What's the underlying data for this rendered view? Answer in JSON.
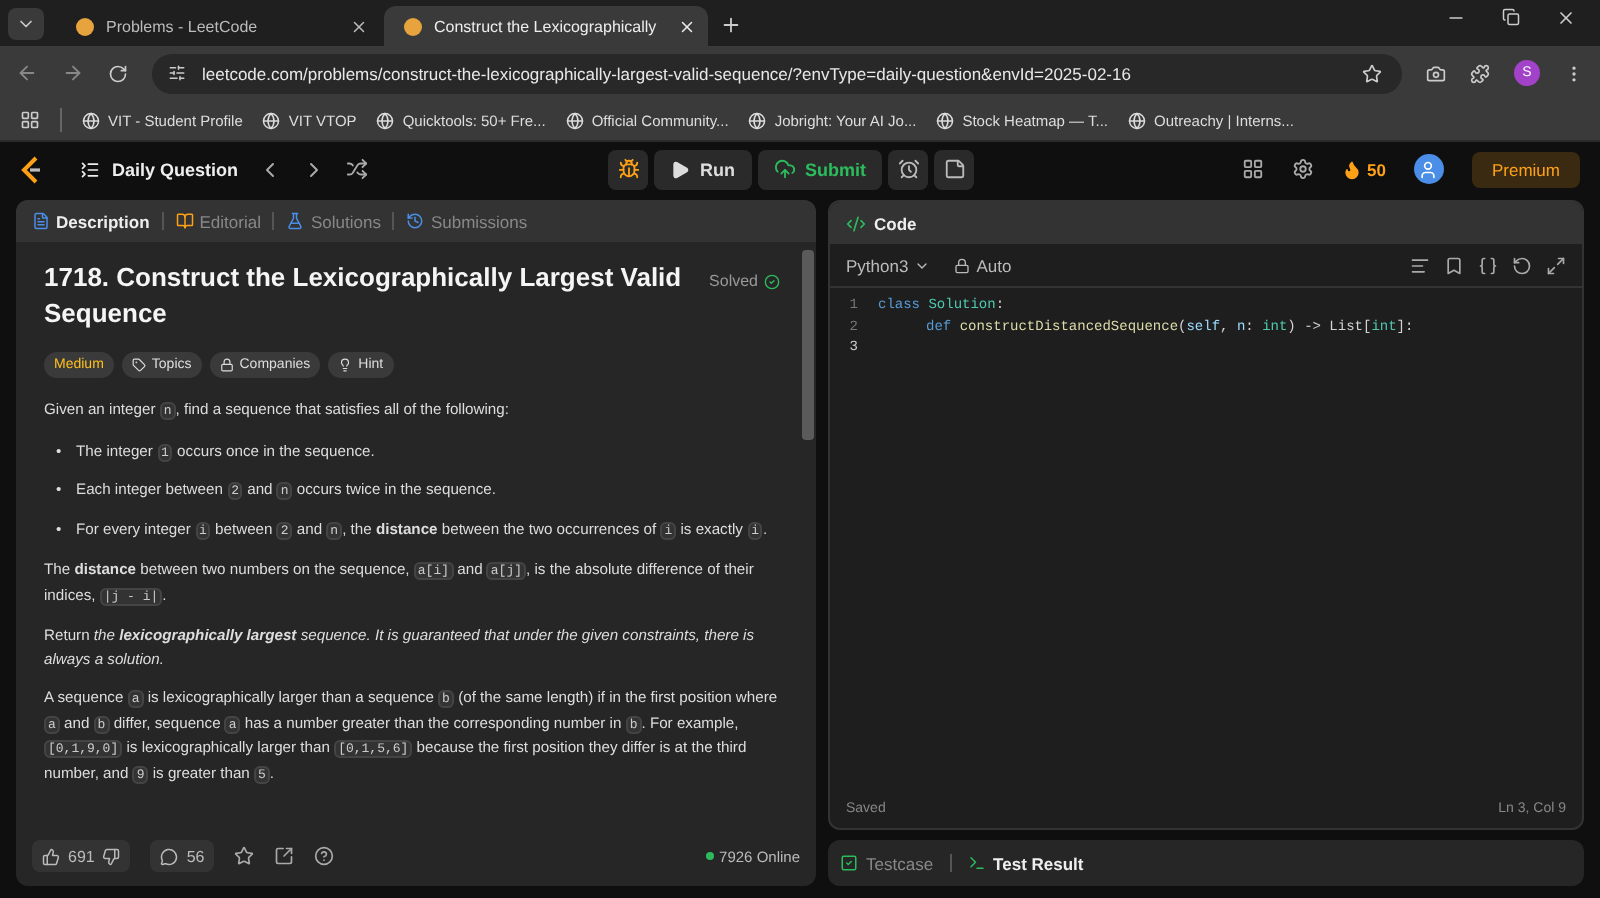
{
  "browser": {
    "tabs": [
      {
        "title": "Problems - LeetCode",
        "selected": false
      },
      {
        "title": "Construct the Lexicographically",
        "selected": true
      }
    ],
    "url": "leetcode.com/problems/construct-the-lexicographically-largest-valid-sequence/?envType=daily-question&envId=2025-02-16",
    "profile_initial": "S",
    "bookmarks": [
      "VIT - Student Profile",
      "VIT VTOP",
      "Quicktools: 50+ Fre...",
      "Official Community...",
      "Jobright: Your AI Jo...",
      "Stock Heatmap — T...",
      "Outreachy | Interns..."
    ]
  },
  "nav": {
    "title": "Daily Question",
    "run": "Run",
    "submit": "Submit",
    "streak": "50",
    "premium": "Premium"
  },
  "problem": {
    "tabs": [
      {
        "label": "Description",
        "selected": true
      },
      {
        "label": "Editorial",
        "selected": false
      },
      {
        "label": "Solutions",
        "selected": false
      },
      {
        "label": "Submissions",
        "selected": false
      }
    ],
    "title": "1718. Construct the Lexicographically Largest Valid Sequence",
    "status": "Solved",
    "difficulty": "Medium",
    "tags": [
      "Topics",
      "Companies",
      "Hint"
    ],
    "intro": [
      {
        "kind": "text",
        "text": "Given an integer "
      },
      {
        "kind": "code",
        "text": "n"
      },
      {
        "kind": "text",
        "text": ", find a sequence that satisfies all of the following:"
      }
    ],
    "bullets": [
      {
        "marker": "•",
        "segments": [
          {
            "kind": "text",
            "text": "The integer "
          },
          {
            "kind": "code",
            "text": "1"
          },
          {
            "kind": "text",
            "text": " occurs once in the sequence."
          }
        ]
      },
      {
        "marker": "•",
        "segments": [
          {
            "kind": "text",
            "text": "Each integer between "
          },
          {
            "kind": "code",
            "text": "2"
          },
          {
            "kind": "text",
            "text": " and "
          },
          {
            "kind": "code",
            "text": "n"
          },
          {
            "kind": "text",
            "text": " occurs twice in the sequence."
          }
        ]
      },
      {
        "marker": "•",
        "segments": [
          {
            "kind": "text",
            "text": "For every integer "
          },
          {
            "kind": "code",
            "text": "i"
          },
          {
            "kind": "text",
            "text": " between "
          },
          {
            "kind": "code",
            "text": "2"
          },
          {
            "kind": "text",
            "text": " and "
          },
          {
            "kind": "code",
            "text": "n"
          },
          {
            "kind": "text",
            "text": ", the **distance** between the two occurrences of "
          },
          {
            "kind": "code",
            "text": "i"
          },
          {
            "kind": "text",
            "text": " is exactly "
          },
          {
            "kind": "code",
            "text": "i"
          },
          {
            "kind": "text",
            "text": "."
          }
        ]
      }
    ],
    "paragraphs": [
      [
        {
          "kind": "text",
          "text": "The **distance** between two numbers on the sequence, "
        },
        {
          "kind": "code",
          "text": "a[i]"
        },
        {
          "kind": "text",
          "text": " and "
        },
        {
          "kind": "code",
          "text": "a[j]"
        },
        {
          "kind": "text",
          "text": ", is the absolute difference of their indices, "
        },
        {
          "kind": "code",
          "text": "|j - i|"
        },
        {
          "kind": "text",
          "text": "."
        }
      ],
      [
        {
          "kind": "text",
          "text": "Return "
        },
        {
          "kind": "italic",
          "text": "the **lexicographically largest** sequence. It is guaranteed that under the given constraints, there is always a solution."
        }
      ],
      [
        {
          "kind": "text",
          "text": "A sequence "
        },
        {
          "kind": "code",
          "text": "a"
        },
        {
          "kind": "text",
          "text": " is lexicographically larger than a sequence "
        },
        {
          "kind": "code",
          "text": "b"
        },
        {
          "kind": "text",
          "text": " (of the same length) if in the first position where "
        },
        {
          "kind": "code",
          "text": "a"
        },
        {
          "kind": "text",
          "text": " and "
        },
        {
          "kind": "code",
          "text": "b"
        },
        {
          "kind": "text",
          "text": " differ, sequence "
        },
        {
          "kind": "code",
          "text": "a"
        },
        {
          "kind": "text",
          "text": " has a number greater than the corresponding number in "
        },
        {
          "kind": "code",
          "text": "b"
        },
        {
          "kind": "text",
          "text": ". For example, "
        },
        {
          "kind": "code",
          "text": "[0,1,9,0]"
        },
        {
          "kind": "text",
          "text": " is lexicographically larger than "
        },
        {
          "kind": "code",
          "text": "[0,1,5,6]"
        },
        {
          "kind": "text",
          "text": " because the first position they differ is at the third number, and "
        },
        {
          "kind": "code",
          "text": "9"
        },
        {
          "kind": "text",
          "text": " is greater than "
        },
        {
          "kind": "code",
          "text": "5"
        },
        {
          "kind": "text",
          "text": "."
        }
      ]
    ],
    "likes": "691",
    "comments": "56",
    "online": "7926 Online"
  },
  "editor": {
    "title": "Code",
    "language": "Python3",
    "mode": "Auto",
    "lines": [
      {
        "number": "1",
        "tokens": [
          {
            "kind": "keyword",
            "text": "class "
          },
          {
            "kind": "class",
            "text": "Solution"
          },
          {
            "kind": "plain",
            "text": ":"
          }
        ]
      },
      {
        "number": "2",
        "indented": true,
        "tokens": [
          {
            "kind": "keyword",
            "text": "def "
          },
          {
            "kind": "func",
            "text": "constructDistancedSequence"
          },
          {
            "kind": "plain",
            "text": "("
          },
          {
            "kind": "param",
            "text": "self"
          },
          {
            "kind": "plain",
            "text": ", "
          },
          {
            "kind": "param",
            "text": "n"
          },
          {
            "kind": "plain",
            "text": ": "
          },
          {
            "kind": "class",
            "text": "int"
          },
          {
            "kind": "plain",
            "text": ") -> List["
          },
          {
            "kind": "class",
            "text": "int"
          },
          {
            "kind": "plain",
            "text": "]:"
          }
        ]
      },
      {
        "number": "3"
      }
    ],
    "status": "Saved",
    "cursor": "Ln 3, Col 9"
  },
  "bottom_tabs": [
    {
      "label": "Testcase",
      "selected": false
    },
    {
      "label": "Test Result",
      "selected": true
    }
  ]
}
